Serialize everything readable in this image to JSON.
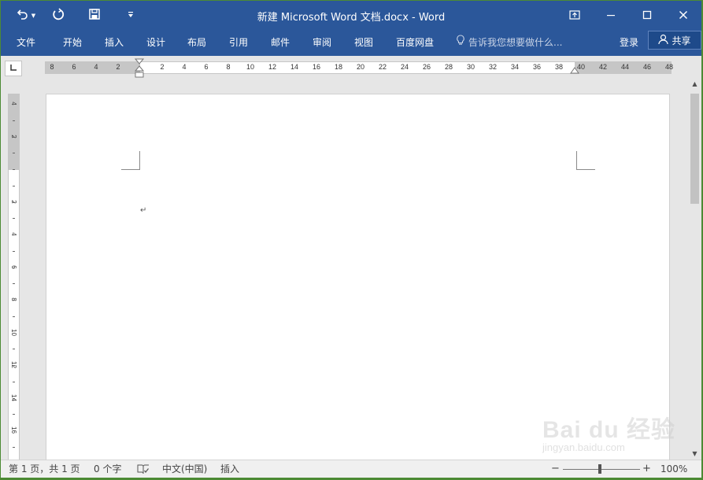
{
  "window": {
    "title": "新建 Microsoft Word 文档.docx - Word",
    "minimize_icon": "minimize-icon",
    "maximize_icon": "maximize-icon",
    "close_icon": "close-icon",
    "ribbon_display_icon": "ribbon-display-options-icon"
  },
  "quick_access": {
    "undo_icon": "undo-icon",
    "undo_dropdown_icon": "chevron-down-icon",
    "redo_icon": "redo-icon",
    "save_icon": "save-icon",
    "customize_icon": "customize-toolbar-icon"
  },
  "ribbon": {
    "tabs": [
      {
        "label": "文件"
      },
      {
        "label": "开始"
      },
      {
        "label": "插入"
      },
      {
        "label": "设计"
      },
      {
        "label": "布局"
      },
      {
        "label": "引用"
      },
      {
        "label": "邮件"
      },
      {
        "label": "审阅"
      },
      {
        "label": "视图"
      },
      {
        "label": "百度网盘"
      }
    ],
    "tell_me": "告诉我您想要做什么...",
    "login": "登录",
    "share": "共享"
  },
  "ruler": {
    "horizontal_numbers": [
      "8",
      "6",
      "4",
      "2",
      "2",
      "4",
      "6",
      "8",
      "10",
      "12",
      "14",
      "16",
      "18",
      "20",
      "22",
      "24",
      "26",
      "28",
      "30",
      "32",
      "34",
      "36",
      "38",
      "40",
      "42",
      "44",
      "46",
      "48"
    ],
    "vertical_numbers": [
      "4",
      "2",
      "2",
      "4",
      "6",
      "8",
      "10",
      "12",
      "14",
      "16"
    ],
    "tab_selector_icon": "tab-selector-icon"
  },
  "document": {
    "paragraph_mark": "↵"
  },
  "status": {
    "page": "第 1 页，共 1 页",
    "words": "0 个字",
    "proofing_icon": "proofing-icon",
    "language": "中文(中国)",
    "mode": "插入",
    "zoom": "100%",
    "zoom_out": "−",
    "zoom_in": "+"
  },
  "watermark": {
    "logo": "Bai du 经验",
    "url": "jingyan.baidu.com"
  }
}
